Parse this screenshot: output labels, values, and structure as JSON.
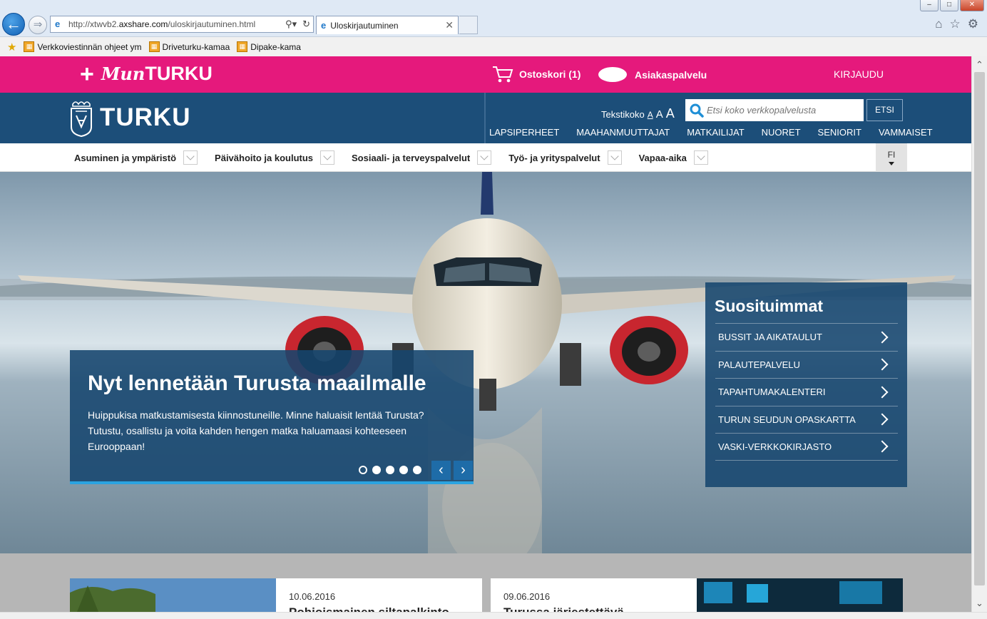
{
  "browser": {
    "url_prefix": "http://xtwvb2.",
    "url_domain": "axshare.com",
    "url_path": "/uloskirjautuminen.html",
    "tab_title": "Uloskirjautuminen",
    "window_controls": [
      "–",
      "□",
      "✕"
    ],
    "favorites": [
      {
        "label": "Verkkoviestinnän ohjeet ym"
      },
      {
        "label": "Driveturku-kamaa"
      },
      {
        "label": "Dipake-kama"
      }
    ]
  },
  "topbar": {
    "logo_mun": "Mun",
    "logo_turku": "TURKU",
    "cart_label": "Ostoskori (1)",
    "customer_service": "Asiakaspalvelu",
    "login": "KIRJAUDU",
    "bg_color": "#e5197c"
  },
  "header": {
    "logo_text": "TURKU",
    "textsize_label": "Tekstikoko",
    "textsize_options": [
      "A",
      "A",
      "A"
    ],
    "search_placeholder": "Etsi koko verkkopalvelusta",
    "search_button": "ETSI",
    "audiences": [
      "LAPSIPERHEET",
      "MAAHANMUUTTAJAT",
      "MATKAILIJAT",
      "NUORET",
      "SENIORIT",
      "VAMMAISET"
    ],
    "bg_color": "#1c4e79"
  },
  "mainnav": {
    "items": [
      {
        "label": "Asuminen ja ympäristö"
      },
      {
        "label": "Päivähoito ja koulutus"
      },
      {
        "label": "Sosiaali- ja terveyspalvelut"
      },
      {
        "label": "Työ- ja yrityspalvelut"
      },
      {
        "label": "Vapaa-aika"
      }
    ],
    "language": "FI"
  },
  "hero": {
    "title": "Nyt lennetään Turusta maailmalle",
    "text": "Huippukisa matkustamisesta kiinnostuneille. Minne haluaisit lentää Turusta? Tutustu, osallistu ja voita kahden hengen matka haluamaasi kohteeseen Eurooppaan!",
    "slide_count": 5,
    "active_slide": 1,
    "prev": "‹",
    "next": "›"
  },
  "popular": {
    "title": "Suosituimmat",
    "items": [
      {
        "label": "BUSSIT JA AIKATAULUT"
      },
      {
        "label": "PALAUTEPALVELU"
      },
      {
        "label": "TAPAHTUMAKALENTERI"
      },
      {
        "label": "TURUN SEUDUN OPASKARTTA"
      },
      {
        "label": "VASKI-VERKKOKIRJASTO"
      }
    ]
  },
  "news": [
    {
      "date": "10.06.2016",
      "title": "Pohjoismainen siltapalkinto"
    },
    {
      "date": "09.06.2016",
      "title": "Turussa järjestettävä"
    }
  ]
}
